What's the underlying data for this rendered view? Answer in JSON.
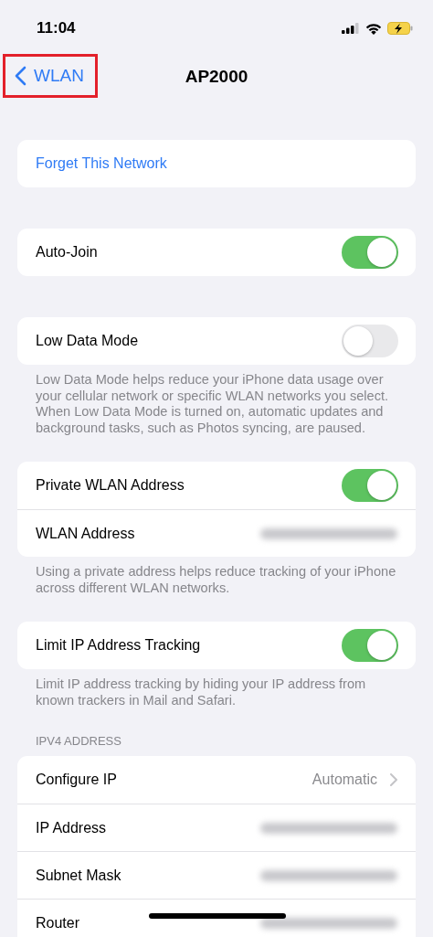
{
  "status_bar": {
    "time": "11:04"
  },
  "nav": {
    "back": {
      "label": "WLAN",
      "highlighted": true
    },
    "title": "AP2000"
  },
  "sections": [
    {
      "rows": [
        {
          "kind": "action",
          "label": "Forget This Network"
        }
      ]
    },
    {
      "rows": [
        {
          "kind": "toggle",
          "label": "Auto-Join",
          "on": true
        }
      ]
    },
    {
      "rows": [
        {
          "kind": "toggle",
          "label": "Low Data Mode",
          "on": false
        }
      ],
      "footer": "Low Data Mode helps reduce your iPhone data usage over your cellular network or specific WLAN networks you select. When Low Data Mode is turned on, automatic updates and background tasks, such as Photos syncing, are paused."
    },
    {
      "rows": [
        {
          "kind": "toggle",
          "label": "Private WLAN Address",
          "on": true
        },
        {
          "kind": "value",
          "label": "WLAN Address",
          "redacted": true
        }
      ],
      "footer": "Using a private address helps reduce tracking of your iPhone across different WLAN networks."
    },
    {
      "rows": [
        {
          "kind": "toggle",
          "label": "Limit IP Address Tracking",
          "on": true
        }
      ],
      "footer": "Limit IP address tracking by hiding your IP address from known trackers in Mail and Safari."
    },
    {
      "header": "IPV4 ADDRESS",
      "rows": [
        {
          "kind": "link",
          "label": "Configure IP",
          "value": "Automatic"
        },
        {
          "kind": "value",
          "label": "IP Address",
          "redacted": true
        },
        {
          "kind": "value",
          "label": "Subnet Mask",
          "redacted": true
        },
        {
          "kind": "value",
          "label": "Router",
          "redacted": true
        }
      ]
    }
  ]
}
